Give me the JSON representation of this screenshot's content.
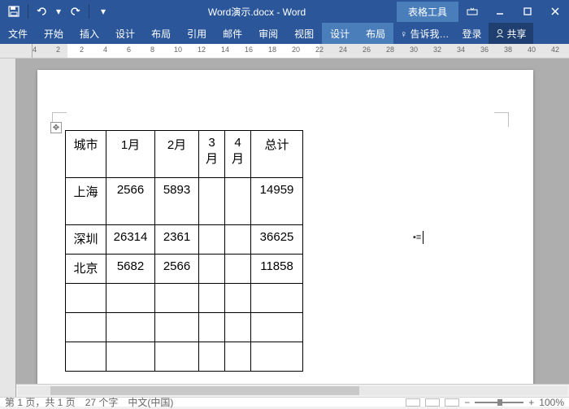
{
  "title": "Word演示.docx - Word",
  "context_tab": "表格工具",
  "tabs": [
    "文件",
    "开始",
    "插入",
    "设计",
    "布局",
    "引用",
    "邮件",
    "审阅",
    "视图"
  ],
  "ctx_tabs": [
    "设计",
    "布局"
  ],
  "tellme": "告诉我…",
  "login": "登录",
  "share": "共享",
  "ruler_marks": [
    "4",
    "2",
    "2",
    "4",
    "6",
    "8",
    "10",
    "12",
    "14",
    "16",
    "18",
    "20",
    "22",
    "24",
    "26",
    "28",
    "30",
    "32",
    "34",
    "36",
    "38",
    "40",
    "42"
  ],
  "table": {
    "headers": [
      "城市",
      "1月",
      "2月",
      "3\n月",
      "4\n月",
      "总计"
    ],
    "rows": [
      [
        "上海",
        "2566",
        "5893",
        "",
        "",
        "14959"
      ],
      [
        "深圳",
        "26314",
        "2361",
        "",
        "",
        "36625"
      ],
      [
        "北京",
        "5682",
        "2566",
        "",
        "",
        "11858"
      ],
      [
        "",
        "",
        "",
        "",
        "",
        ""
      ],
      [
        "",
        "",
        "",
        "",
        "",
        ""
      ],
      [
        "",
        "",
        "",
        "",
        "",
        ""
      ]
    ]
  },
  "status": {
    "page": "第 1 页，共 1 页",
    "words": "27 个字",
    "lang": "中文(中国)",
    "zoom": "100%"
  }
}
